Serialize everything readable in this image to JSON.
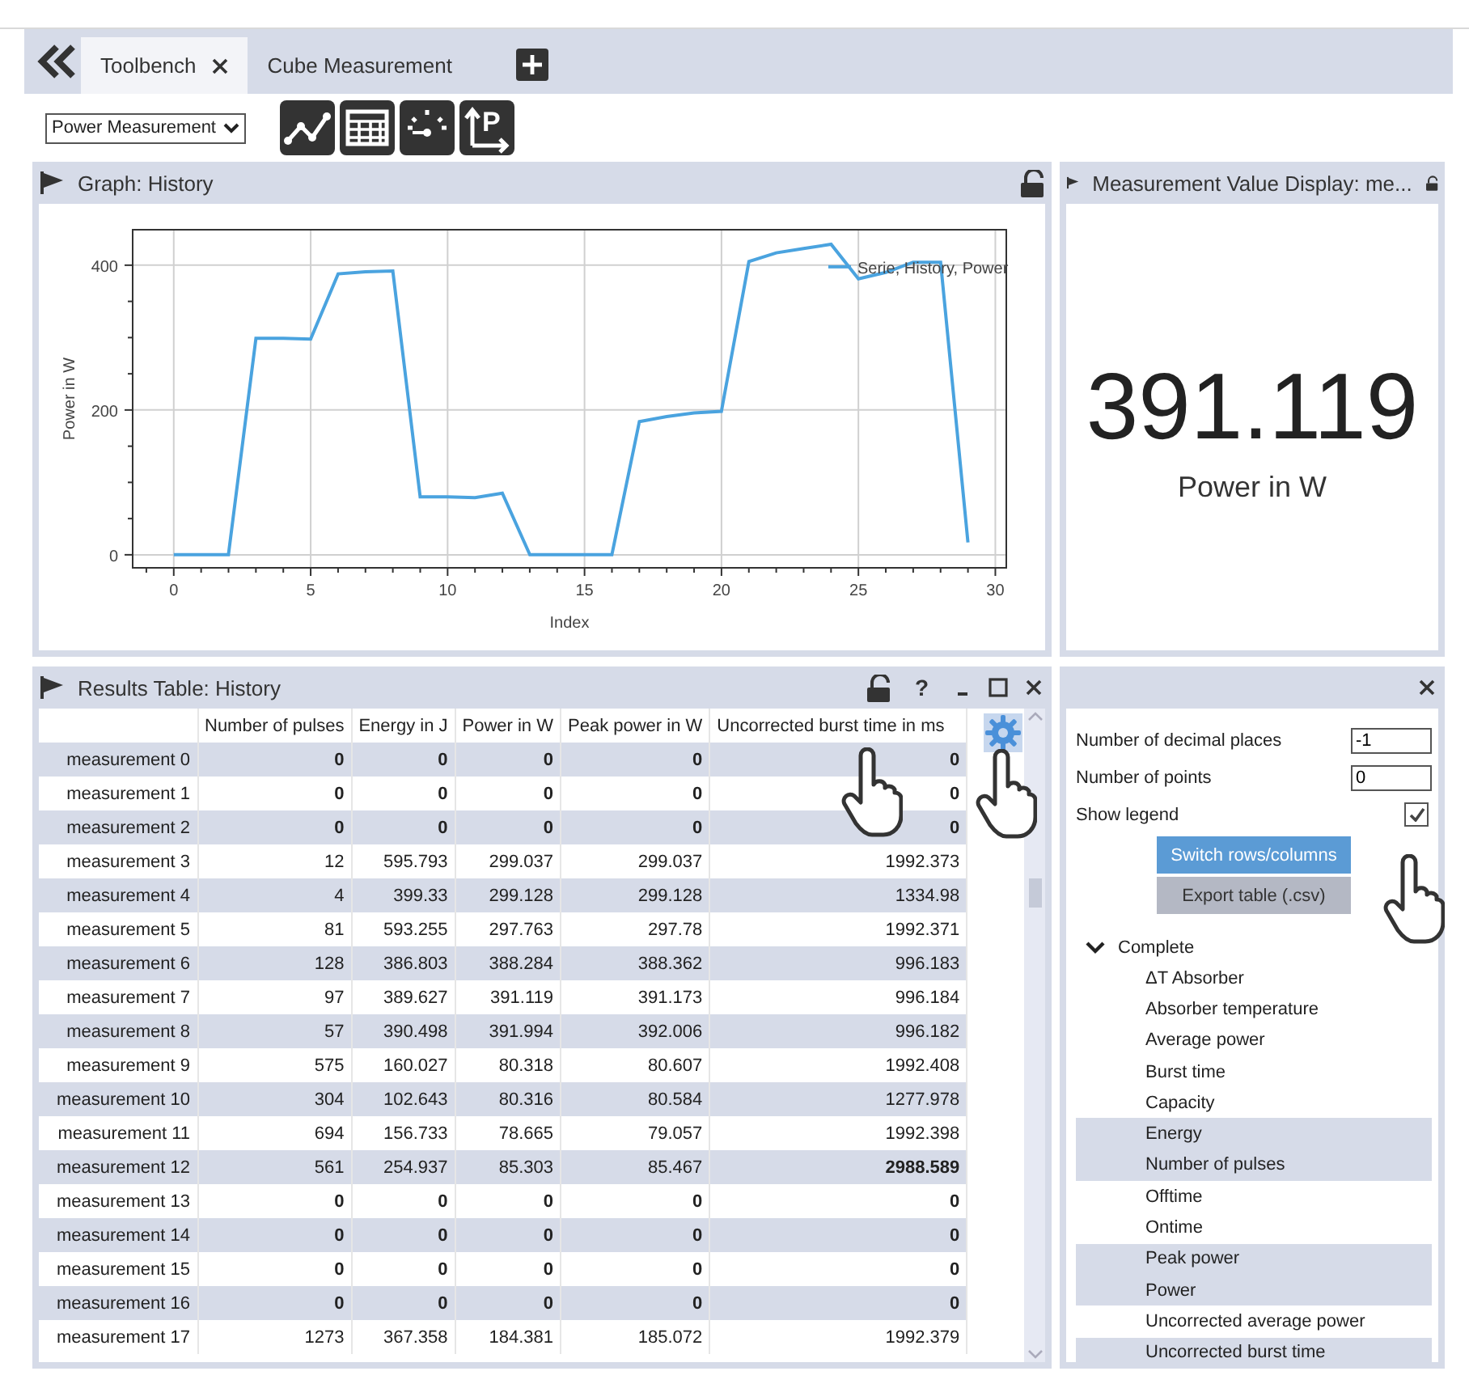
{
  "tabs": [
    {
      "label": "Toolbench",
      "selected": true,
      "closable": true
    },
    {
      "label": "Cube Measurement",
      "selected": false,
      "closable": false
    }
  ],
  "toolbar": {
    "dropdown": "Power Measurement",
    "buttons": [
      {
        "kind": "line-chart"
      },
      {
        "kind": "table"
      },
      {
        "kind": "gauge"
      },
      {
        "kind": "axis",
        "glyph": "P"
      }
    ]
  },
  "graph_panel": {
    "title": "Graph: History",
    "chart_data": {
      "type": "line",
      "xlabel": "Index",
      "ylabel": "Power  in W",
      "x": [
        0,
        1,
        2,
        3,
        4,
        5,
        6,
        7,
        8,
        9,
        10,
        11,
        12,
        13,
        14,
        15,
        16,
        17,
        18,
        19,
        20,
        21,
        22,
        23,
        24,
        25,
        26,
        27,
        28,
        29
      ],
      "series": [
        {
          "name": "Serie, History, Power",
          "color": "#4aa3df",
          "values": [
            0,
            0,
            0,
            299,
            299,
            298,
            388,
            391,
            392,
            80,
            80,
            79,
            85,
            0,
            0,
            0,
            0,
            184,
            191,
            196,
            198,
            405,
            417,
            423,
            429,
            381,
            390,
            404,
            404,
            17
          ]
        }
      ],
      "grid": true,
      "xlim": [
        -1.5,
        30.4
      ],
      "ylim": [
        -18,
        449
      ],
      "xticks": [
        0,
        5,
        10,
        15,
        20,
        25,
        30
      ],
      "yticks": [
        0,
        200,
        400
      ]
    }
  },
  "value_panel": {
    "title": "Measurement Value Display: me...",
    "value": "391.119",
    "unit": "Power in W"
  },
  "table_panel": {
    "title": "Results Table: History",
    "header_buttons": [
      "?"
    ],
    "columns": [
      "Number of pulses",
      "Energy in J",
      "Power in W",
      "Peak power in W",
      "Uncorrected burst time in ms"
    ],
    "rows": [
      {
        "label": "measurement 0",
        "cells": [
          {
            "text": "0",
            "bold": true
          },
          {
            "text": "0",
            "bold": true
          },
          {
            "text": "0",
            "bold": true
          },
          {
            "text": "0",
            "bold": true
          },
          {
            "text": "0",
            "bold": true
          }
        ]
      },
      {
        "label": "measurement 1",
        "cells": [
          {
            "text": "0",
            "bold": true
          },
          {
            "text": "0",
            "bold": true
          },
          {
            "text": "0",
            "bold": true
          },
          {
            "text": "0",
            "bold": true
          },
          {
            "text": "0",
            "bold": true
          }
        ]
      },
      {
        "label": "measurement 2",
        "cells": [
          {
            "text": "0",
            "bold": true
          },
          {
            "text": "0",
            "bold": true
          },
          {
            "text": "0",
            "bold": true
          },
          {
            "text": "0",
            "bold": true
          },
          {
            "text": "0",
            "bold": true
          }
        ]
      },
      {
        "label": "measurement 3",
        "cells": [
          {
            "text": "12",
            "bold": false
          },
          {
            "text": "595.793",
            "bold": false
          },
          {
            "text": "299.037",
            "bold": false
          },
          {
            "text": "299.037",
            "bold": false
          },
          {
            "text": "1992.373",
            "bold": false
          }
        ]
      },
      {
        "label": "measurement 4",
        "cells": [
          {
            "text": "4",
            "bold": false
          },
          {
            "text": "399.33",
            "bold": false
          },
          {
            "text": "299.128",
            "bold": false
          },
          {
            "text": "299.128",
            "bold": false
          },
          {
            "text": "1334.98",
            "bold": false
          }
        ]
      },
      {
        "label": "measurement 5",
        "cells": [
          {
            "text": "81",
            "bold": false
          },
          {
            "text": "593.255",
            "bold": false
          },
          {
            "text": "297.763",
            "bold": false
          },
          {
            "text": "297.78",
            "bold": false
          },
          {
            "text": "1992.371",
            "bold": false
          }
        ]
      },
      {
        "label": "measurement 6",
        "cells": [
          {
            "text": "128",
            "bold": false
          },
          {
            "text": "386.803",
            "bold": false
          },
          {
            "text": "388.284",
            "bold": false
          },
          {
            "text": "388.362",
            "bold": false
          },
          {
            "text": "996.183",
            "bold": false
          }
        ]
      },
      {
        "label": "measurement 7",
        "cells": [
          {
            "text": "97",
            "bold": false
          },
          {
            "text": "389.627",
            "bold": false
          },
          {
            "text": "391.119",
            "bold": false
          },
          {
            "text": "391.173",
            "bold": false
          },
          {
            "text": "996.184",
            "bold": false
          }
        ]
      },
      {
        "label": "measurement 8",
        "cells": [
          {
            "text": "57",
            "bold": false
          },
          {
            "text": "390.498",
            "bold": false
          },
          {
            "text": "391.994",
            "bold": false
          },
          {
            "text": "392.006",
            "bold": false
          },
          {
            "text": "996.182",
            "bold": false
          }
        ]
      },
      {
        "label": "measurement 9",
        "cells": [
          {
            "text": "575",
            "bold": false
          },
          {
            "text": "160.027",
            "bold": false
          },
          {
            "text": "80.318",
            "bold": false
          },
          {
            "text": "80.607",
            "bold": false
          },
          {
            "text": "1992.408",
            "bold": false
          }
        ]
      },
      {
        "label": "measurement 10",
        "cells": [
          {
            "text": "304",
            "bold": false
          },
          {
            "text": "102.643",
            "bold": false
          },
          {
            "text": "80.316",
            "bold": false
          },
          {
            "text": "80.584",
            "bold": false
          },
          {
            "text": "1277.978",
            "bold": false
          }
        ]
      },
      {
        "label": "measurement 11",
        "cells": [
          {
            "text": "694",
            "bold": false
          },
          {
            "text": "156.733",
            "bold": false
          },
          {
            "text": "78.665",
            "bold": false
          },
          {
            "text": "79.057",
            "bold": false
          },
          {
            "text": "1992.398",
            "bold": false
          }
        ]
      },
      {
        "label": "measurement 12",
        "cells": [
          {
            "text": "561",
            "bold": false
          },
          {
            "text": "254.937",
            "bold": false
          },
          {
            "text": "85.303",
            "bold": false
          },
          {
            "text": "85.467",
            "bold": false
          },
          {
            "text": "2988.589",
            "bold": true
          }
        ]
      },
      {
        "label": "measurement 13",
        "cells": [
          {
            "text": "0",
            "bold": true
          },
          {
            "text": "0",
            "bold": true
          },
          {
            "text": "0",
            "bold": true
          },
          {
            "text": "0",
            "bold": true
          },
          {
            "text": "0",
            "bold": true
          }
        ]
      },
      {
        "label": "measurement 14",
        "cells": [
          {
            "text": "0",
            "bold": true
          },
          {
            "text": "0",
            "bold": true
          },
          {
            "text": "0",
            "bold": true
          },
          {
            "text": "0",
            "bold": true
          },
          {
            "text": "0",
            "bold": true
          }
        ]
      },
      {
        "label": "measurement 15",
        "cells": [
          {
            "text": "0",
            "bold": true
          },
          {
            "text": "0",
            "bold": true
          },
          {
            "text": "0",
            "bold": true
          },
          {
            "text": "0",
            "bold": true
          },
          {
            "text": "0",
            "bold": true
          }
        ]
      },
      {
        "label": "measurement 16",
        "cells": [
          {
            "text": "0",
            "bold": true
          },
          {
            "text": "0",
            "bold": true
          },
          {
            "text": "0",
            "bold": true
          },
          {
            "text": "0",
            "bold": true
          },
          {
            "text": "0",
            "bold": true
          }
        ]
      },
      {
        "label": "measurement 17",
        "cells": [
          {
            "text": "1273",
            "bold": false
          },
          {
            "text": "367.358",
            "bold": false
          },
          {
            "text": "184.381",
            "bold": false
          },
          {
            "text": "185.072",
            "bold": false
          },
          {
            "text": "1992.379",
            "bold": false
          }
        ]
      }
    ]
  },
  "settings_panel": {
    "fields": [
      {
        "label": "Number of decimal places",
        "value": "-1"
      },
      {
        "label": "Number of points",
        "value": "0"
      }
    ],
    "show_legend": {
      "label": "Show legend",
      "checked": true
    },
    "buttons": [
      {
        "label": "Switch rows/columns",
        "kind": "primary"
      },
      {
        "label": "Export table (.csv)",
        "kind": "secondary"
      }
    ],
    "tree": {
      "label": "Complete",
      "expanded": true,
      "children": [
        {
          "label": "ΔT Absorber",
          "selected": false
        },
        {
          "label": "Absorber temperature",
          "selected": false
        },
        {
          "label": "Average power",
          "selected": false
        },
        {
          "label": "Burst time",
          "selected": false
        },
        {
          "label": "Capacity",
          "selected": false
        },
        {
          "label": "Energy",
          "selected": true
        },
        {
          "label": "Number of pulses",
          "selected": true
        },
        {
          "label": "Offtime",
          "selected": false
        },
        {
          "label": "Ontime",
          "selected": false
        },
        {
          "label": "Peak power",
          "selected": true
        },
        {
          "label": "Power",
          "selected": true
        },
        {
          "label": "Uncorrected average power",
          "selected": false
        },
        {
          "label": "Uncorrected burst time",
          "selected": true
        }
      ]
    }
  }
}
